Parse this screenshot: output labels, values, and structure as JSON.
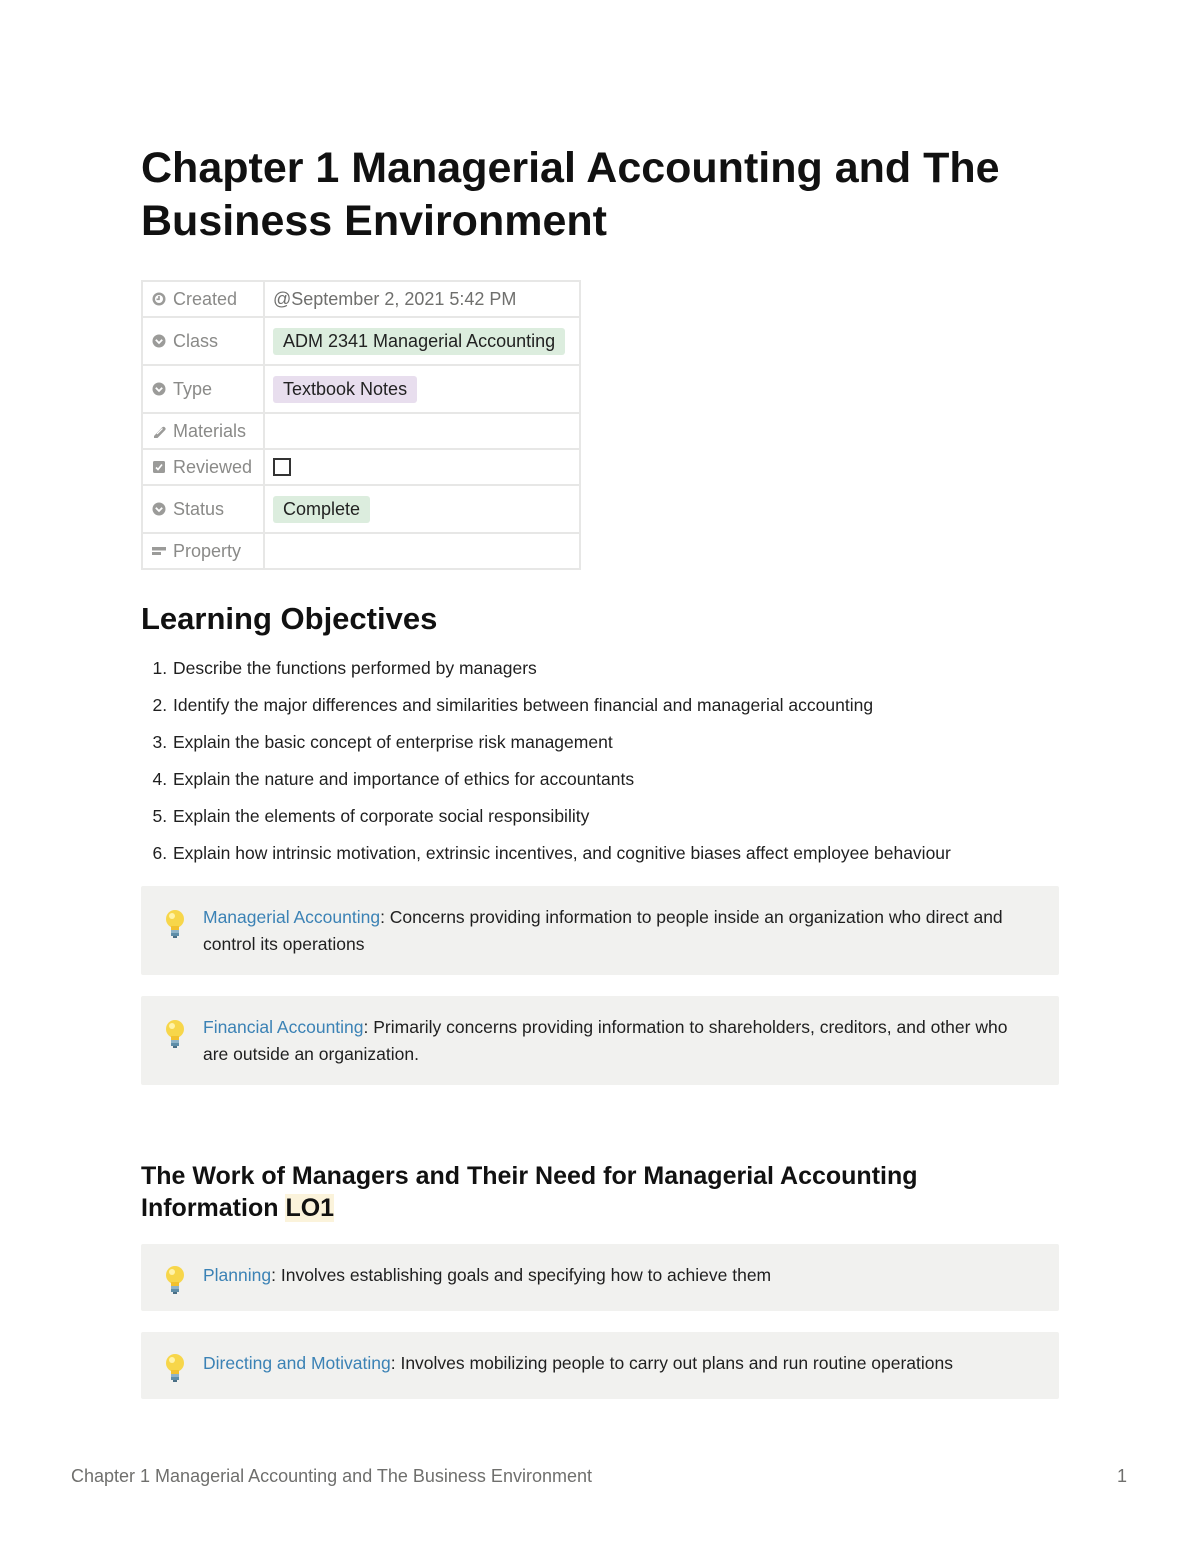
{
  "document": {
    "title": "Chapter 1 Managerial Accounting and The Business Environment"
  },
  "properties": [
    {
      "icon": "clock-icon",
      "label": "Created",
      "value": "@September 2, 2021 5:42 PM",
      "kind": "text"
    },
    {
      "icon": "select-icon",
      "label": "Class",
      "value": "ADM 2341 Managerial Accounting",
      "kind": "tag",
      "tag_color": "#dcedde"
    },
    {
      "icon": "select-icon",
      "label": "Type",
      "value": "Textbook Notes",
      "kind": "tag",
      "tag_color": "#e8deee"
    },
    {
      "icon": "attachment-icon",
      "label": "Materials",
      "value": "",
      "kind": "empty"
    },
    {
      "icon": "checkbox-icon",
      "label": "Reviewed",
      "value": false,
      "kind": "checkbox"
    },
    {
      "icon": "select-icon",
      "label": "Status",
      "value": "Complete",
      "kind": "tag",
      "tag_color": "#dcedde"
    },
    {
      "icon": "text-icon",
      "label": "Property",
      "value": "",
      "kind": "empty"
    }
  ],
  "learning_objectives": {
    "heading": "Learning Objectives",
    "items": [
      "Describe the functions performed by managers",
      "Identify the major differences and similarities between financial and managerial accounting",
      "Explain the basic concept of enterprise risk management",
      "Explain the nature and importance of ethics for accountants",
      "Explain the elements of corporate social responsibility",
      "Explain how intrinsic motivation, extrinsic incentives, and cognitive biases affect employee behaviour"
    ]
  },
  "callouts": [
    {
      "icon": "lightbulb-icon",
      "term": "Managerial Accounting",
      "text": ": Concerns providing information to people inside an organization who direct and control its operations"
    },
    {
      "icon": "lightbulb-icon",
      "term": "Financial Accounting",
      "text": ": Primarily concerns providing information to shareholders, creditors, and other who are outside an organization."
    }
  ],
  "section": {
    "heading": "The Work of Managers and Their Need for Managerial Accounting Information ",
    "highlight": "LO1",
    "callouts": [
      {
        "icon": "lightbulb-icon",
        "term": "Planning",
        "text": ": Involves establishing goals and specifying how to achieve them"
      },
      {
        "icon": "lightbulb-icon",
        "term": "Directing and Motivating",
        "text": ": Involves mobilizing people to carry out plans and run routine operations"
      }
    ]
  },
  "footer": {
    "title": "Chapter 1 Managerial Accounting and The Business Environment",
    "page": "1"
  },
  "colors": {
    "term_link": "#3b82b5",
    "callout_bg": "#f1f1ef",
    "highlight_bg": "#fbf3db"
  }
}
